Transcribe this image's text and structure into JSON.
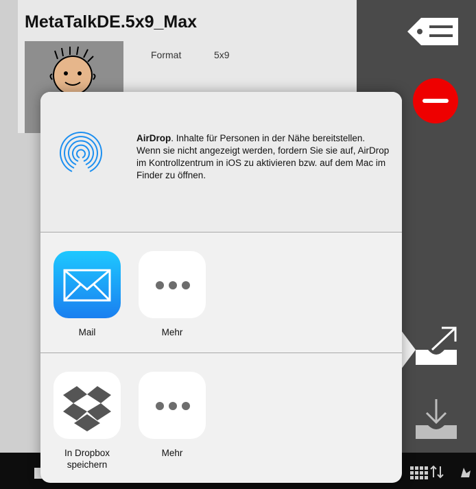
{
  "background_app": {
    "title": "MetaTalkDE.5x9_Max",
    "format_label": "Format",
    "format_value": "5x9"
  },
  "icons": {
    "tag": "tag-list-icon",
    "delete": "delete-icon",
    "share": "share-export-icon",
    "download": "download-icon"
  },
  "share_sheet": {
    "airdrop": {
      "name": "AirDrop",
      "text": ". Inhalte für Personen in der Nähe bereitstellen. Wenn sie nicht angezeigt werden, fordern Sie sie auf, AirDrop im Kontrollzentrum in iOS zu aktivieren bzw. auf dem Mac im Finder zu öffnen."
    },
    "row1": [
      {
        "label": "Mail",
        "icon": "mail-icon"
      },
      {
        "label": "Mehr",
        "icon": "more-icon"
      }
    ],
    "row2": [
      {
        "label": "In Dropbox speichern",
        "icon": "dropbox-icon"
      },
      {
        "label": "Mehr",
        "icon": "more-icon"
      }
    ]
  },
  "colors": {
    "delete_red": "#e00000",
    "mail_blue": "#1a7ff0",
    "airdrop_blue": "#1c8ff0"
  }
}
